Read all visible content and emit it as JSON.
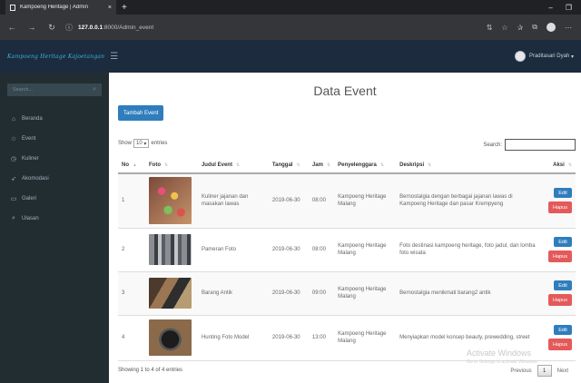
{
  "browser": {
    "tab_title": "Kampoeng Heritage | Admin",
    "tab_close": "×",
    "new_tab": "+",
    "url_host": "127.0.0.1",
    "url_path": ":8000/Admin_event",
    "minimize": "–",
    "restore": "❐",
    "close": "—"
  },
  "app": {
    "brand": "Kampoeng Heritage Kajoetangan",
    "user_name": "Praditasari Dyah",
    "sidebar": {
      "search_placeholder": "Search...",
      "items": [
        {
          "label": "Beranda",
          "icon": "home-icon"
        },
        {
          "label": "Event",
          "icon": "star-icon"
        },
        {
          "label": "Kuliner",
          "icon": "clock-icon"
        },
        {
          "label": "Akomodasi",
          "icon": "send-icon"
        },
        {
          "label": "Galeri",
          "icon": "image-icon"
        },
        {
          "label": "Ulasan",
          "icon": "search-icon"
        }
      ]
    }
  },
  "main": {
    "title": "Data Event",
    "add_button": "Tambah Event",
    "show_label": "Show",
    "show_value": "10",
    "entries_label": "entries",
    "search_label": "Search:",
    "columns": [
      "No",
      "Foto",
      "Judul Event",
      "Tanggal",
      "Jam",
      "Penyelenggara",
      "Deskripsi",
      "Aksi"
    ],
    "rows": [
      {
        "no": "1",
        "judul": "Kuliner jajanan dan masakan lawas",
        "tanggal": "2019-06-30",
        "jam": "08:00",
        "penyelenggara": "Kampoeng Heritage Malang",
        "deskripsi": "Bernostalgia dengan berbagai jajanan lawas di Kampoeng Heritage dan pasar Krempyeng"
      },
      {
        "no": "2",
        "judul": "Pameran Foto",
        "tanggal": "2019-06-30",
        "jam": "08:00",
        "penyelenggara": "Kampoeng Heritage Malang",
        "deskripsi": "Foto destinasi kampoeng heritage, foto jadul, dan lomba foto wisata"
      },
      {
        "no": "3",
        "judul": "Barang Antik",
        "tanggal": "2019-06-30",
        "jam": "09:00",
        "penyelenggara": "Kampoeng Heritage Malang",
        "deskripsi": "Bernostalgia menikmati barang2 antik"
      },
      {
        "no": "4",
        "judul": "Hunting Foto Model",
        "tanggal": "2019-06-30",
        "jam": "13:00",
        "penyelenggara": "Kampoeng Heritage Malang",
        "deskripsi": "Menyiapkan model konsep beauty, prewedding, street"
      }
    ],
    "edit_label": "Edit",
    "delete_label": "Hapus",
    "info": "Showing 1 to 4 of 4 entries",
    "previous": "Previous",
    "current_page": "1",
    "next": "Next"
  },
  "os": {
    "watermark": "Activate Windows",
    "watermark_sub": "Go to Settings to activate Windows."
  }
}
